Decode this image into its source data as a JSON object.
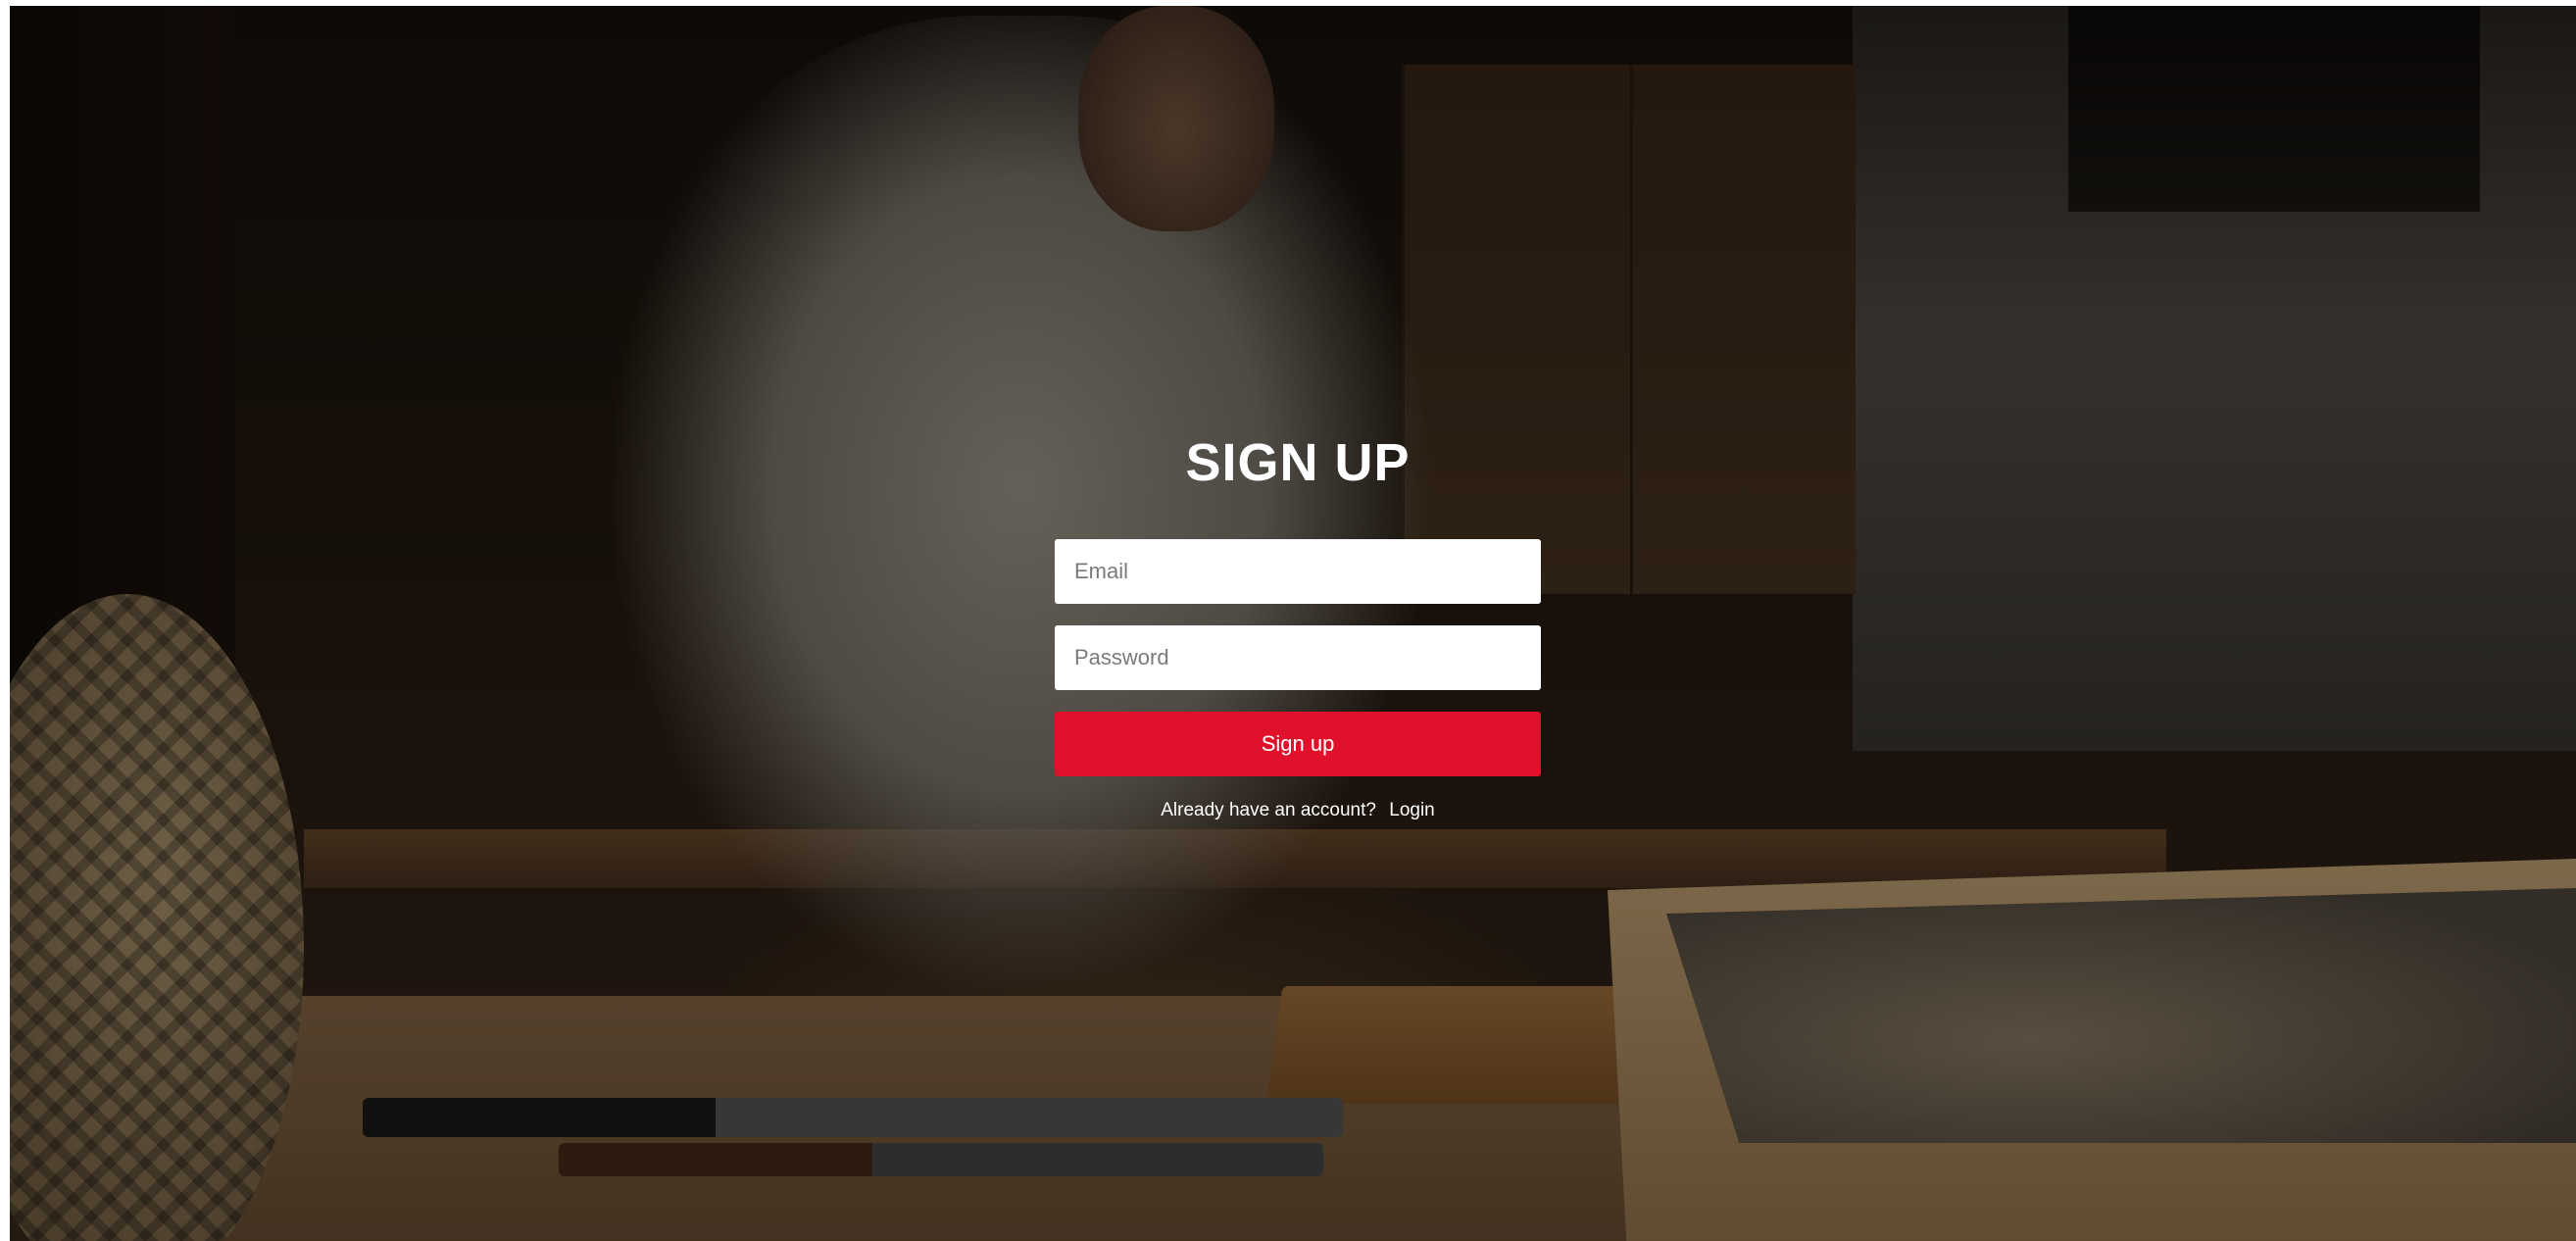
{
  "signup": {
    "title": "SIGN UP",
    "email_placeholder": "Email",
    "password_placeholder": "Password",
    "submit_label": "Sign up",
    "account_prompt": "Already have an account?",
    "login_link": "Login"
  },
  "colors": {
    "submit_button": "#e0112b",
    "text": "#ffffff"
  }
}
